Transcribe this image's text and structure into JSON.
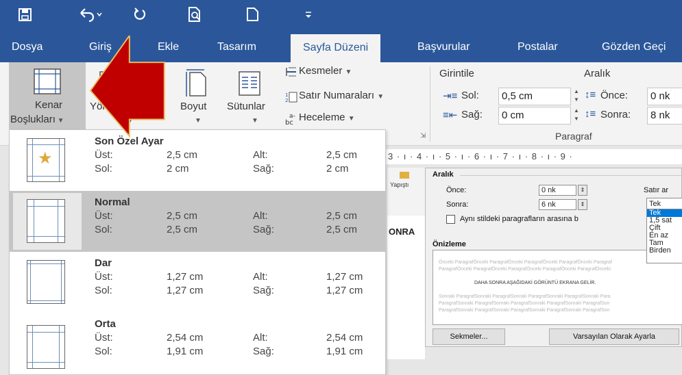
{
  "quick_access": {
    "save_icon": "save-icon",
    "undo_icon": "undo-icon",
    "redo_icon": "redo-icon",
    "print_preview_icon": "print-preview-icon",
    "new_icon": "new-document-icon",
    "customize_icon": "customize-icon"
  },
  "tabs": [
    {
      "label": "Dosya"
    },
    {
      "label": "Giriş"
    },
    {
      "label": "Ekle"
    },
    {
      "label": "Tasarım"
    },
    {
      "label": "Sayfa Düzeni",
      "active": true
    },
    {
      "label": "Başvurular"
    },
    {
      "label": "Postalar"
    },
    {
      "label": "Gözden Geçi"
    }
  ],
  "ribbon": {
    "kenar_line1": "Kenar",
    "kenar_line2": "Boşlukları",
    "yonlendirme": "Yönlendirme",
    "boyut": "Boyut",
    "sutunlar": "Sütunlar",
    "kesmeler": "Kesmeler",
    "satir_numaralari": "Satır Numaraları",
    "heceleme": "Heceleme",
    "girintile": "Girintile",
    "sol_label": "Sol:",
    "sol_value": "0,5 cm",
    "sag_label": "Sağ:",
    "sag_value": "0 cm",
    "aralik": "Aralık",
    "once_label": "Önce:",
    "once_value": "0 nk",
    "sonra_label": "Sonra:",
    "sonra_value": "8 nk",
    "paragraf_group": "Paragraf"
  },
  "ruler": {
    "text": "3 · ı · 4 · ı · 5 · ı · 6 · ı · 7 · ı · 8 · ı · 9 ·"
  },
  "dialog": {
    "yapistir": "Yapıştı",
    "onra": "ONRA",
    "aralik_label": "Aralık",
    "once_label": "Önce:",
    "once_value": "0 nk",
    "sonra_label": "Sonra:",
    "sonra_value": "6 nk",
    "satir_label": "Satır ar",
    "satir_value": "Tek",
    "checkbox_label": "Aynı stildeki paragrafların arasına b",
    "onizleme": "Önizleme",
    "list_options": [
      "Tek",
      "1,5 sat",
      "Çift",
      "En az",
      "Tam",
      "Birden"
    ],
    "preview_lines": [
      "Önceki ParagrafÖnceki ParagrafÖnceki ParagrafÖnceki ParagrafÖnceki Paragraf",
      "ParagrafÖnceki ParagrafÖnceki ParagrafÖnceki ParagrafÖnceki ParagrafÖnceki",
      "DAHA SONRA AŞAĞIDAKİ GÖRÜNTÜ EKRANA GELİR.",
      "Sonraki ParagrafSonraki ParagrafSonraki ParagrafSonraki ParagrafSonraki Para",
      "ParagrafSonraki ParagrafSonraki ParagrafSonraki ParagrafSonraki ParagrafSon",
      "ParagrafSonraki ParagrafSonraki ParagrafSonraki ParagrafSonraki ParagrafSon"
    ],
    "sekmeler_button": "Sekmeler...",
    "varsayilan_button": "Varsayılan Olarak Ayarla"
  },
  "margins_menu": {
    "items": [
      {
        "title": "Son Özel Ayar",
        "ust_label": "Üst:",
        "ust": "2,5 cm",
        "alt_label": "Alt:",
        "alt": "2,5 cm",
        "sol_label": "Sol:",
        "sol": "2 cm",
        "sag_label": "Sağ:",
        "sag": "2 cm",
        "icon": "star-margin-icon"
      },
      {
        "title": "Normal",
        "ust_label": "Üst:",
        "ust": "2,5 cm",
        "alt_label": "Alt:",
        "alt": "2,5 cm",
        "sol_label": "Sol:",
        "sol": "2,5 cm",
        "sag_label": "Sağ:",
        "sag": "2,5 cm",
        "selected": true,
        "icon": "normal-margin-icon"
      },
      {
        "title": "Dar",
        "ust_label": "Üst:",
        "ust": "1,27 cm",
        "alt_label": "Alt:",
        "alt": "1,27 cm",
        "sol_label": "Sol:",
        "sol": "1,27 cm",
        "sag_label": "Sağ:",
        "sag": "1,27 cm",
        "icon": "narrow-margin-icon"
      },
      {
        "title": "Orta",
        "ust_label": "Üst:",
        "ust": "2,54 cm",
        "alt_label": "Alt:",
        "alt": "2,54 cm",
        "sol_label": "Sol:",
        "sol": "1,91 cm",
        "sag_label": "Sağ:",
        "sag": "1,91 cm",
        "icon": "moderate-margin-icon"
      }
    ]
  },
  "colors": {
    "title_bar": "#2b579a",
    "ribbon": "#f3f3f3",
    "selected_item": "#c5c5c5",
    "arrow": "#c00000"
  }
}
